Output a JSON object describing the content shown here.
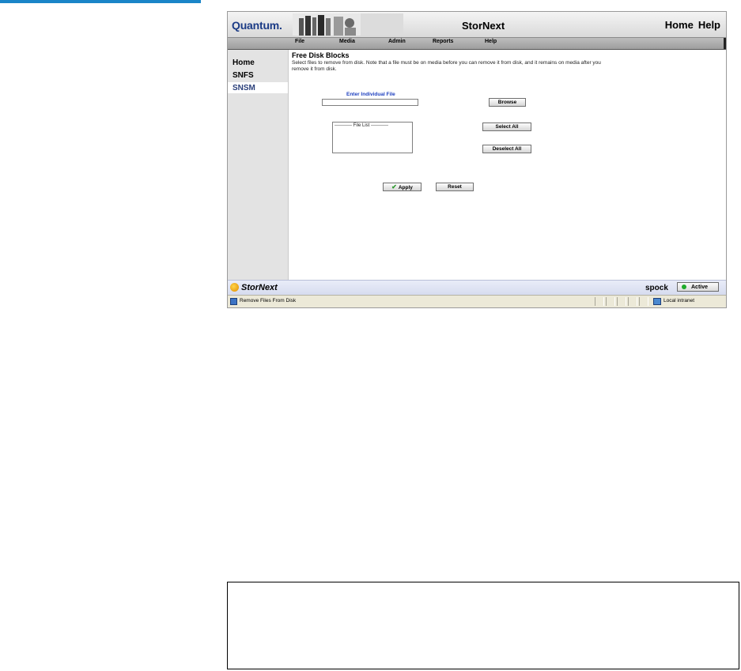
{
  "header": {
    "logo": "Quantum",
    "logo_dot": ".",
    "app_title": "StorNext",
    "links": [
      "Home",
      "Help"
    ]
  },
  "menu": [
    "File",
    "Media",
    "Admin",
    "Reports",
    "Help"
  ],
  "sidebar": {
    "items": [
      "Home",
      "SNFS",
      "SNSM"
    ],
    "active": "SNSM"
  },
  "main": {
    "title": "Free Disk Blocks",
    "description": "Select files to remove from disk. Note that a file must be on media before you can remove it from disk, and it remains on media after you remove it from disk.",
    "field_label": "Enter Individual File",
    "field_value": "",
    "browse_label": "Browse",
    "file_list_placeholder": "----------- File List -----------",
    "select_all_label": "Select All",
    "deselect_all_label": "Deselect All",
    "apply_label": "Apply",
    "reset_label": "Reset"
  },
  "footer": {
    "brand": "StorNext",
    "host": "spock",
    "status": "Active",
    "status_color": "#1faa2a"
  },
  "browser_status": {
    "text": "Remove Files From Disk",
    "zone": "Local intranet"
  },
  "colors": {
    "accent_rule": "#1a85c8",
    "logo": "#1b3b86",
    "label_blue": "#1d3fbf"
  },
  "icons": [
    "server-banner-icon",
    "checkmark-icon",
    "stornext-logo-icon",
    "status-dot-icon",
    "page-icon",
    "intranet-zone-icon"
  ]
}
